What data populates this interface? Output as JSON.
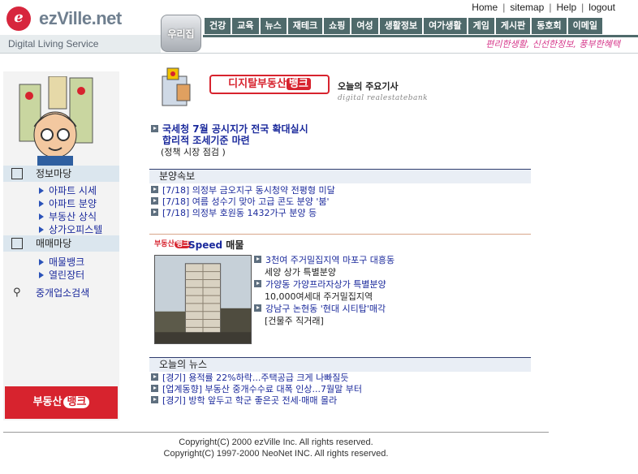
{
  "header": {
    "logo": "ezVille.net",
    "logo_sub": "Digital Living Service",
    "util_links": [
      "Home",
      "sitemap",
      "Help",
      "logout"
    ],
    "home_button": "우리집",
    "nav_tabs": [
      "건강",
      "교육",
      "뉴스",
      "재테크",
      "쇼핑",
      "여성",
      "생활정보",
      "여가생활",
      "게임",
      "게시판",
      "동호회",
      "이메일"
    ],
    "slogan": "편리한생활, 신선한정보, 풍부한혜택"
  },
  "sidebar": {
    "sections": [
      {
        "title": "정보마당",
        "items": [
          "아파트 시세",
          "아파트 분양",
          "부동산 상식",
          "상가오피스텔"
        ]
      },
      {
        "title": "매매마당",
        "items": [
          "매물뱅크",
          "열린장터"
        ]
      }
    ],
    "agent_search": "중개업소검색",
    "bank_banner": {
      "text": "부동산",
      "badge": "뱅크"
    }
  },
  "banner": {
    "title": "디지탈부동산",
    "title_badge": "뱅크",
    "today_label": "오늘의 주요기사",
    "sub": "digital realestatebank"
  },
  "headline": {
    "line1": "국세청 7월 공시지가 전국 확대실시",
    "line2": "합리적 조세기준 마련",
    "line3": "(정책 시장 점검 )"
  },
  "sale_news": {
    "title": "분양속보",
    "items": [
      "[7/18] 의정부 금오지구 동시청약 전평형 미달",
      "[7/18] 여름 성수기 맞아 고급 콘도 분양 '붐'",
      "[7/18] 의정부 호원동 1432가구 분양 등"
    ]
  },
  "speed": {
    "logo": "부동산",
    "logo_badge": "뱅크",
    "title_prefix": "Speed",
    "title_suffix": "매물",
    "items": [
      {
        "title": "3천여 주거밀집지역 마포구 대흥동",
        "sub": "세양 상가 특별분양"
      },
      {
        "title": "가양동 가양프라자상가 특별분양",
        "sub": "10,000여세대 주거밀집지역"
      },
      {
        "title": "강남구 논현동 '현대 시티탑'매각",
        "sub": "[건물주 직거래]"
      }
    ]
  },
  "today_news": {
    "title": "오늘의 뉴스",
    "items": [
      "[경기] 용적률 22%하락...주택공급 크게 나빠질듯",
      "[업계동향] 부동산 중개수수료 대폭 인상...7월말 부터",
      "[경기] 방학 앞두고 학군 좋은곳 전세·매매 몰라"
    ]
  },
  "footer": {
    "line1": "Copyright(C) 2000 ezVille Inc. All rights reserved.",
    "line2": "Copyright(C) 1997-2000 NeoNet INC. All rights reserved."
  }
}
